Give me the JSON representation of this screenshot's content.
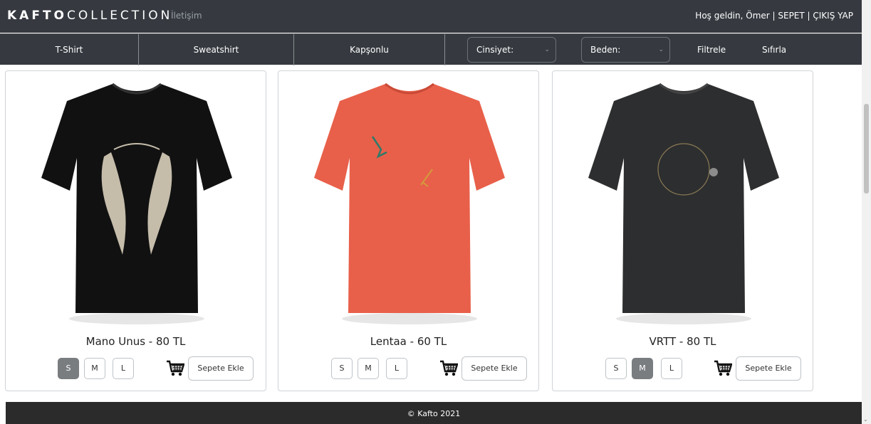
{
  "header": {
    "brand_bold": "KAFTO",
    "brand_light": "COLLECTION",
    "contact": "İletişim",
    "user_links": "Hoş geldin, Ömer | SEPET | ÇIKIŞ YAP"
  },
  "nav": {
    "categories": [
      "T-Shirt",
      "Sweatshirt",
      "Kapşonlu"
    ],
    "gender_select": "Cinsiyet:",
    "size_select": "Beden:",
    "filter": "Filtrele",
    "reset": "Sıfırla"
  },
  "products": [
    {
      "name": "Mano Unus - 80 TL",
      "sizes": [
        "S",
        "M",
        "L"
      ],
      "selected_size": "S",
      "shirt_color": "#111111",
      "add_label": "Sepete Ekle"
    },
    {
      "name": "Lentaa - 60 TL",
      "sizes": [
        "S",
        "M",
        "L"
      ],
      "selected_size": "",
      "shirt_color": "#e8604a",
      "add_label": "Sepete Ekle"
    },
    {
      "name": "VRTT - 80 TL",
      "sizes": [
        "S",
        "M",
        "L"
      ],
      "selected_size": "M",
      "shirt_color": "#2d2e2f",
      "add_label": "Sepete Ekle"
    }
  ],
  "footer": {
    "text": "© Kafto 2021"
  },
  "icons": {
    "cart": "cart-icon",
    "chevron": "chevron-down-icon"
  }
}
